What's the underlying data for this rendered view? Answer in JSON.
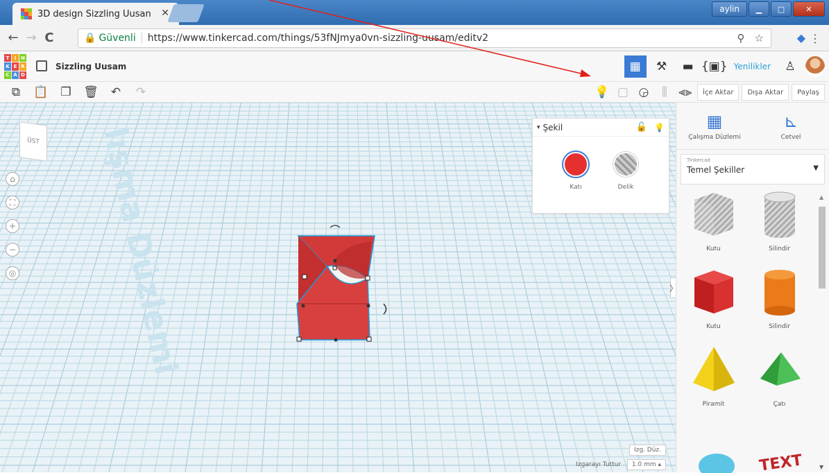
{
  "browser": {
    "tab_title": "3D design Sizzling Uusan",
    "tab_close": "✕",
    "window_user": "aylin",
    "min_glyph": "▁",
    "max_glyph": "□",
    "close_glyph": "✕"
  },
  "address": {
    "back": "←",
    "forward": "→",
    "reload": "C",
    "secure_label": "Güvenli",
    "url": "https://www.tinkercad.com/things/53fNJmya0vn-sizzling-uusam/editv2",
    "zoom_icon": "zoom-icon",
    "star_icon": "star-icon"
  },
  "header": {
    "logo_letters": [
      "T",
      "I",
      "N",
      "K",
      "E",
      "R",
      "C",
      "A",
      "D"
    ],
    "project_name": "Sizzling Uusam",
    "news_label": "Yenilikler"
  },
  "toolbar": {
    "import_label": "İçe Aktar",
    "export_label": "Dışa Aktar",
    "share_label": "Paylaş"
  },
  "workplane": {
    "plane_text": "lışma Düzlemi",
    "view_cube_label": "ÜST",
    "edit_grid_label": "Izg. Düz.",
    "snap_label": "Izgarayı Tuttur",
    "snap_value": "1.0 mm"
  },
  "shape_panel": {
    "title": "Şekil",
    "solid_label": "Katı",
    "hole_label": "Delik"
  },
  "right_panel": {
    "workplane_tool": "Çalışma Düzlemi",
    "ruler_tool": "Cetvel",
    "library_small": "Tinkercad",
    "library_name": "Temel Şekiller",
    "shapes": [
      {
        "label": "Kutu",
        "kind": "box-hole"
      },
      {
        "label": "Silindir",
        "kind": "cyl-hole"
      },
      {
        "label": "Kutu",
        "kind": "box"
      },
      {
        "label": "Silindir",
        "kind": "cyl"
      },
      {
        "label": "Piramit",
        "kind": "pyramid"
      },
      {
        "label": "Çatı",
        "kind": "roof"
      }
    ]
  },
  "colors": {
    "accent": "#3a7bd5",
    "solid": "#e63030",
    "grid_bg": "#e9f2f6",
    "grid_line": "#b8d6e4"
  }
}
